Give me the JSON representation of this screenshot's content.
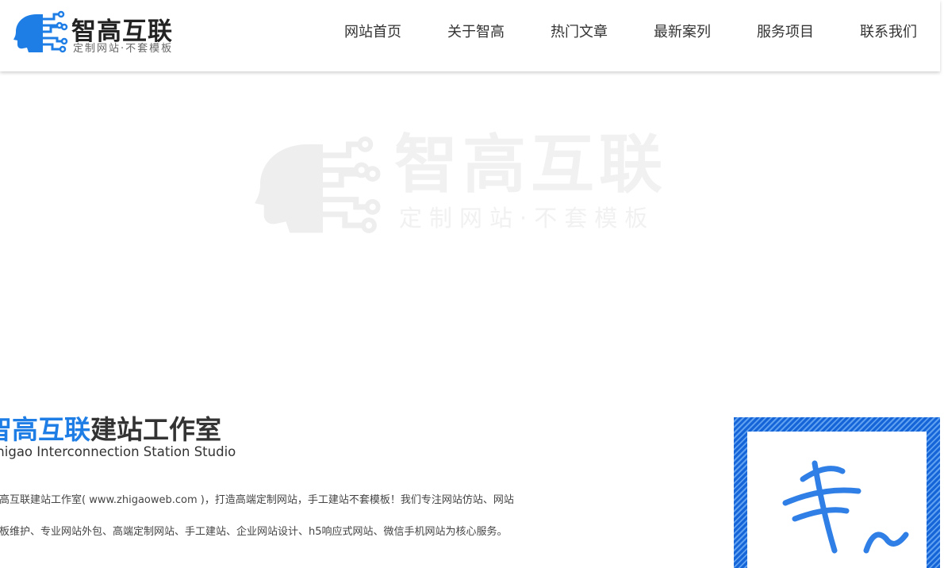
{
  "header": {
    "logo_title": "智高互联",
    "logo_subtitle": "定制网站·不套模板",
    "nav": [
      {
        "label": "网站首页"
      },
      {
        "label": "关于智高"
      },
      {
        "label": "热门文章"
      },
      {
        "label": "最新案列"
      },
      {
        "label": "服务项目"
      },
      {
        "label": "联系我们"
      }
    ]
  },
  "watermark": {
    "title": "智高互联",
    "subtitle": "定制网站·不套模板"
  },
  "studio": {
    "title_highlight": "智高互联",
    "title_rest": "建站工作室",
    "subtitle_en": "Zhigao Interconnection Station Studio",
    "paragraph_1": "智高互联建站工作室( www.zhigaoweb.com )，打造高端定制网站，手工建站不套模板！我们专注网站仿站、网站",
    "paragraph_2": "模板维护、专业网站外包、高端定制网站、手工建站、企业网站设计、h5响应式网站、微信手机网站为核心服务。"
  },
  "colors": {
    "brand_blue": "#1e7ee6",
    "watermark_gray": "#f1f1f1"
  },
  "icons": {
    "logo": "ai-head-circuit-icon",
    "decor_image": "professional-calligraphy-banner"
  }
}
